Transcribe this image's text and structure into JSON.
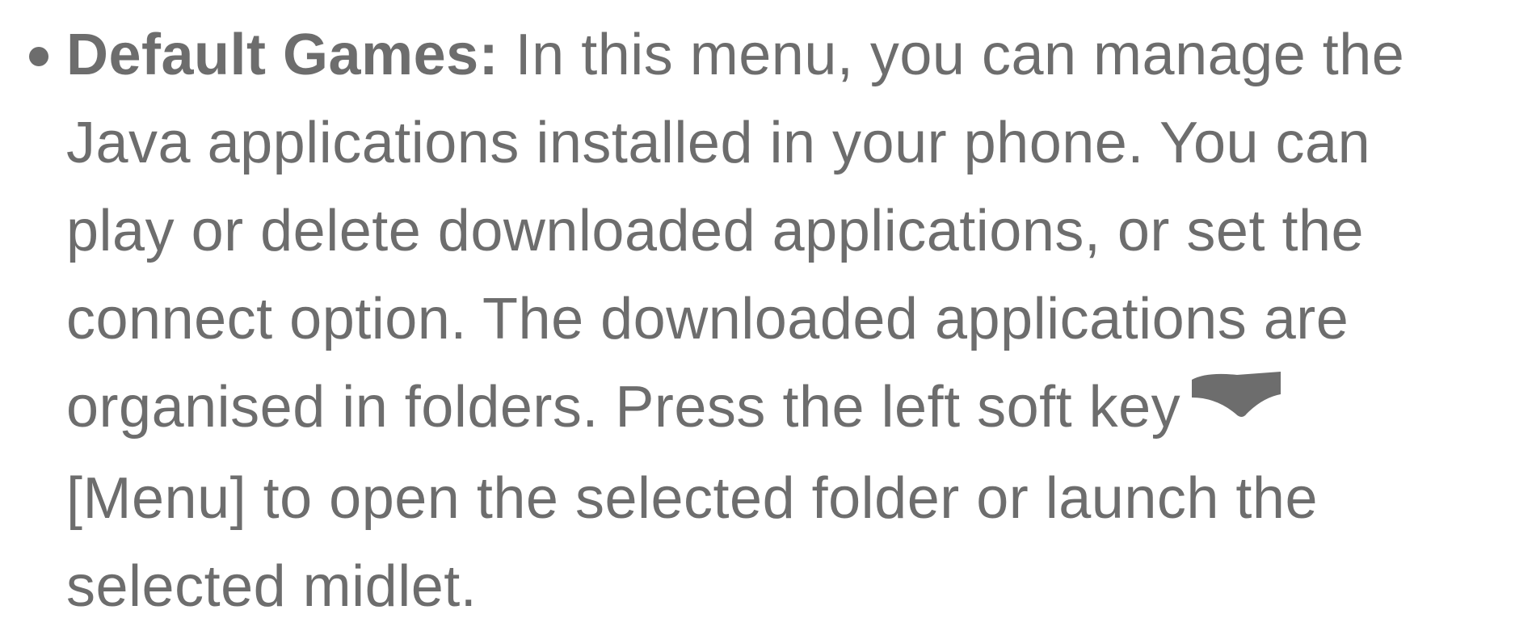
{
  "entry": {
    "term": "Default Games:",
    "lines": [
      " In this menu, you can manage the",
      "Java applications installed in your phone. You can",
      "play or delete downloaded applications, or set the",
      "connect option. The downloaded applications are",
      "organised in folders. Press the left soft key",
      "[Menu] to open the selected folder or launch the",
      "selected midlet."
    ],
    "icon": "left-soft-key-icon"
  },
  "colors": {
    "text": "#6d6d6d"
  }
}
